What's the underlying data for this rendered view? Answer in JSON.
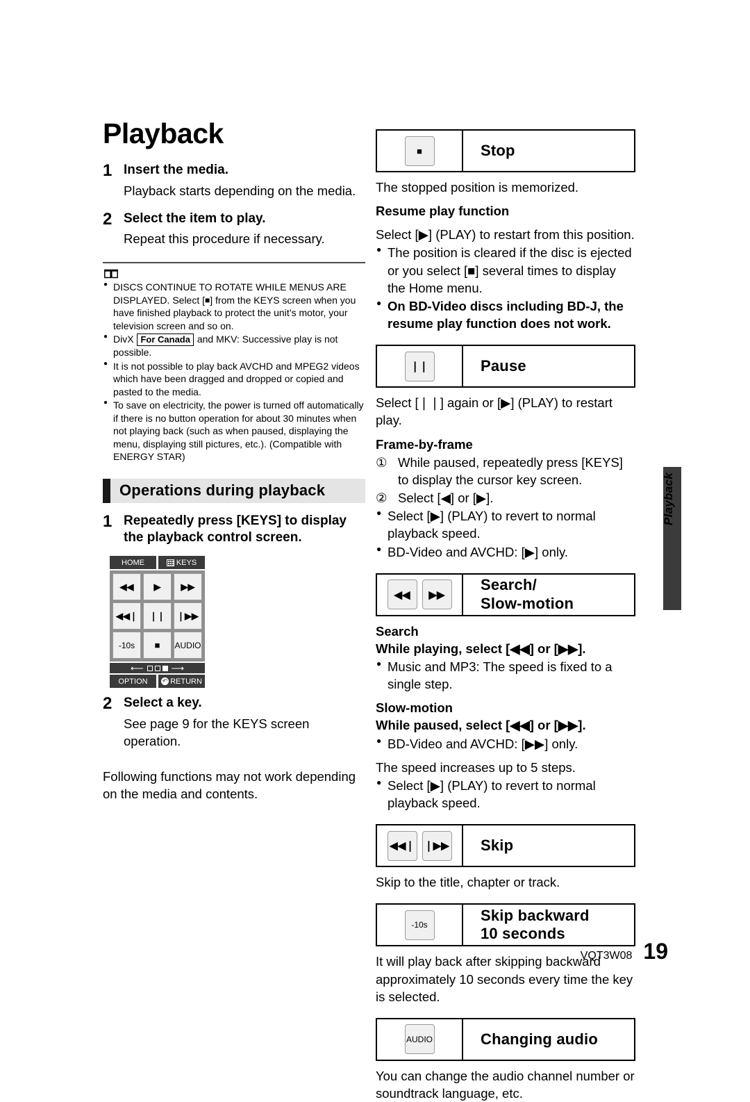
{
  "document": {
    "title": "Playback",
    "thumb_tab_label": "Playback",
    "footer_code": "VQT3W08",
    "footer_page": "19"
  },
  "steps_main": [
    {
      "num": "1",
      "heading": "Insert the media.",
      "detail": "Playback starts depending on the media."
    },
    {
      "num": "2",
      "heading": "Select the item to play.",
      "detail": "Repeat this procedure if necessary."
    }
  ],
  "notes": {
    "icon": "open-book-icon",
    "items": [
      {
        "pre": "DISCS CONTINUE TO ROTATE WHILE MENUS ARE DISPLAYED. Select [",
        "sym": "■",
        "post": "] from the KEYS screen when you have finished playback to protect the unit’s motor, your television screen and so on."
      },
      {
        "pre": "DivX ",
        "badge": "For Canada",
        "post": " and MKV: Successive play is not possible."
      },
      {
        "text": "It is not possible to play back AVCHD and MPEG2 videos which have been dragged and dropped or copied and pasted to the media."
      },
      {
        "text": "To save on electricity, the power is turned off automatically if there is no button operation for about 30 minutes when not playing back (such as when paused, displaying the menu, displaying still pictures, etc.). (Compatible with ENERGY STAR)"
      }
    ]
  },
  "section": {
    "bar_title": "Operations during playback",
    "step1": {
      "num": "1",
      "heading": "Repeatedly press [KEYS] to display the playback control screen."
    },
    "step2": {
      "num": "2",
      "heading": "Select a key.",
      "detail": "See page 9 for the KEYS screen operation."
    },
    "closing_para": "Following functions may not work depending on the media and contents."
  },
  "keys_screen": {
    "home_label": "HOME",
    "keys_label": "KEYS",
    "keys_icon": "grid-icon",
    "pad": [
      {
        "name": "rewind",
        "glyph": "◀◀"
      },
      {
        "name": "play",
        "glyph": "▶"
      },
      {
        "name": "fast-forward",
        "glyph": "▶▶"
      },
      {
        "name": "skip-back",
        "glyph": "◀◀❘"
      },
      {
        "name": "pause",
        "glyph": "❘❘"
      },
      {
        "name": "skip-next",
        "glyph": "❘▶▶"
      },
      {
        "name": "skip-back-10s",
        "glyph": "-10s"
      },
      {
        "name": "stop",
        "glyph": "■"
      },
      {
        "name": "audio",
        "glyph": "AUDIO"
      }
    ],
    "pager": {
      "left_arrow": "⟵",
      "right_arrow": "⟶",
      "dots": 3,
      "active_dot": 3
    },
    "option_label": "OPTION",
    "return_label": "RETURN",
    "return_icon": "return-arrow-icon"
  },
  "functions": [
    {
      "name": "stop",
      "icons": [
        {
          "glyph": "■",
          "kind": "sq-ic"
        }
      ],
      "title": "Stop",
      "blocks": [
        {
          "type": "para",
          "text": "The stopped position is memorized."
        },
        {
          "type": "bold",
          "text": "Resume play function"
        },
        {
          "type": "para",
          "text": "Select [▶] (PLAY) to restart from this position."
        },
        {
          "type": "list",
          "items": [
            {
              "text": "The position is cleared if the disc is ejected or you select [■] several times to display the Home menu.",
              "bold": false
            },
            {
              "text": "On BD-Video discs including BD-J, the resume play function does not work.",
              "bold": true
            }
          ]
        }
      ]
    },
    {
      "name": "pause",
      "icons": [
        {
          "glyph": "❘❘",
          "kind": ""
        }
      ],
      "title": "Pause",
      "blocks": [
        {
          "type": "para",
          "text": "Select [❘❘] again or [▶] (PLAY) to restart play."
        },
        {
          "type": "bold",
          "text": "Frame-by-frame"
        },
        {
          "type": "olist",
          "items": [
            {
              "marker": "①",
              "text": "While paused, repeatedly press [KEYS] to display the cursor key screen."
            },
            {
              "marker": "②",
              "text": "Select [◀] or [▶]."
            }
          ]
        },
        {
          "type": "list",
          "items": [
            {
              "text": "Select [▶] (PLAY) to revert to normal playback speed.",
              "bold": false
            },
            {
              "text": "BD-Video and AVCHD: [▶] only.",
              "bold": false
            }
          ]
        }
      ]
    },
    {
      "name": "search-slow-motion",
      "icons": [
        {
          "glyph": "◀◀",
          "kind": ""
        },
        {
          "glyph": "▶▶",
          "kind": ""
        }
      ],
      "title": "Search/\nSlow-motion",
      "blocks": [
        {
          "type": "bold",
          "text": "Search"
        },
        {
          "type": "bold",
          "text": "While playing, select [◀◀] or [▶▶]."
        },
        {
          "type": "list",
          "items": [
            {
              "text": "Music and MP3: The speed is fixed to a single step.",
              "bold": false
            }
          ]
        },
        {
          "type": "bold",
          "text": "Slow-motion"
        },
        {
          "type": "bold",
          "text": "While paused, select [◀◀] or [▶▶]."
        },
        {
          "type": "list",
          "items": [
            {
              "text": "BD-Video and AVCHD: [▶▶] only.",
              "bold": false
            }
          ]
        },
        {
          "type": "para",
          "text": "The speed increases up to 5 steps."
        },
        {
          "type": "list",
          "items": [
            {
              "text": "Select [▶] (PLAY) to revert to normal playback speed.",
              "bold": false
            }
          ]
        }
      ]
    },
    {
      "name": "skip",
      "icons": [
        {
          "glyph": "◀◀❘",
          "kind": ""
        },
        {
          "glyph": "❘▶▶",
          "kind": ""
        }
      ],
      "title": "Skip",
      "blocks": [
        {
          "type": "para",
          "text": "Skip to the title, chapter or track."
        }
      ]
    },
    {
      "name": "skip-backward-10-seconds",
      "icons": [
        {
          "glyph": "-10s",
          "kind": "tiny"
        }
      ],
      "title": "Skip backward\n10 seconds",
      "blocks": [
        {
          "type": "para",
          "text": "It will play back after skipping backward approximately 10 seconds every time the key is selected."
        }
      ]
    },
    {
      "name": "changing-audio",
      "icons": [
        {
          "glyph": "AUDIO",
          "kind": "tiny"
        }
      ],
      "title": "Changing audio",
      "blocks": [
        {
          "type": "para",
          "text": "You can change the audio channel number or soundtrack language, etc."
        }
      ]
    }
  ]
}
